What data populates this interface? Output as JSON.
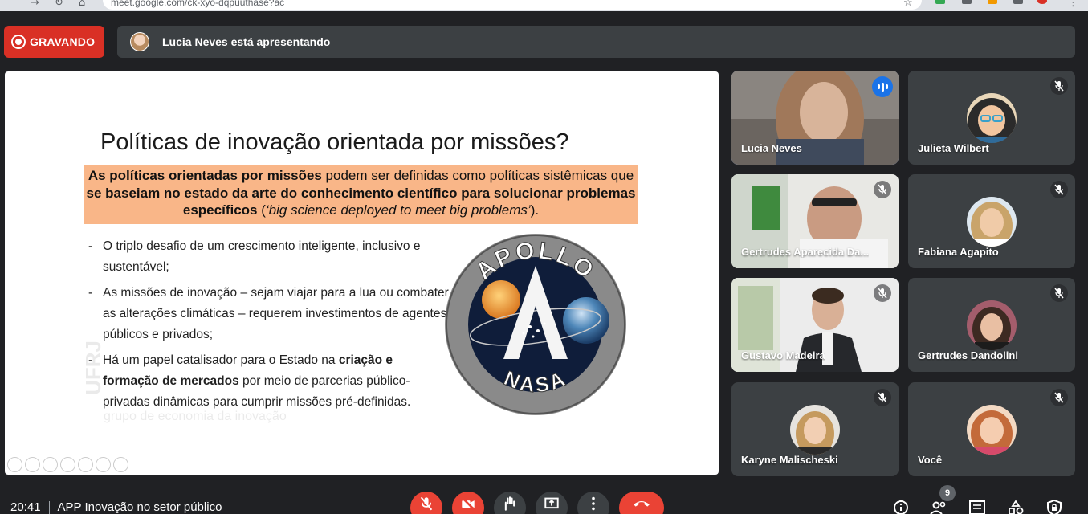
{
  "browser": {
    "url": "meet.google.com/ck-xyo-dqpuuthase?ac"
  },
  "recording": {
    "label": "GRAVANDO"
  },
  "presenting": {
    "text": "Lucia Neves está apresentando"
  },
  "slide": {
    "title": "Políticas de inovação orientada por missões?",
    "box_parts": [
      "As políticas orientadas por missões",
      " podem ser definidas como políticas sistêmicas que ",
      "se baseiam no estado da arte do conhecimento científico para solucionar problemas específicos",
      " (",
      "‘big science deployed to meet big problems’",
      ")."
    ],
    "bullets": [
      {
        "parts": [
          "O triplo desafio de um crescimento inteligente, inclusivo e sustentável;"
        ]
      },
      {
        "parts": [
          "As missões de inovação – sejam viajar para a lua ou combater as alterações climáticas – requerem investimentos de agentes públicos e privados;"
        ]
      },
      {
        "parts": [
          "Há um papel catalisador para o Estado na ",
          "criação e formação de mercados",
          " por meio de parcerias público-privadas dinâmicas para cumprir missões pré-definidas."
        ]
      }
    ],
    "watermark": {
      "logo": "UFRJ",
      "text": "grupo de economia da inovação"
    },
    "apollo": {
      "top": "APOLLO",
      "bottom": "NASA"
    }
  },
  "participants": [
    {
      "name": "Lucia Neves",
      "speaking": true
    },
    {
      "name": "Julieta Wilbert",
      "muted": true
    },
    {
      "name": "Gertrudes Aparecida Da...",
      "muted": true
    },
    {
      "name": "Fabiana Agapito",
      "muted": true
    },
    {
      "name": "Gustavo Madeira",
      "muted": true
    },
    {
      "name": "Gertrudes Dandolini",
      "muted": true
    },
    {
      "name": "Karyne Malischeski",
      "muted": true
    },
    {
      "name": "Você",
      "muted": true
    }
  ],
  "bottom": {
    "time": "20:41",
    "meeting_title": "APP Inovação no setor público",
    "participant_count": "9"
  },
  "colors": {
    "record_red": "#d93025",
    "hangup_red": "#ea4335",
    "active_blue": "#8ab4f8",
    "speaking_blue": "#1a73e8",
    "highlight_orange": "#f9b688"
  },
  "icons": [
    "mic-off-icon",
    "camera-off-icon",
    "raise-hand-icon",
    "present-screen-icon",
    "more-options-icon",
    "hang-up-icon",
    "info-icon",
    "people-icon",
    "chat-icon",
    "activities-icon",
    "host-controls-icon"
  ]
}
